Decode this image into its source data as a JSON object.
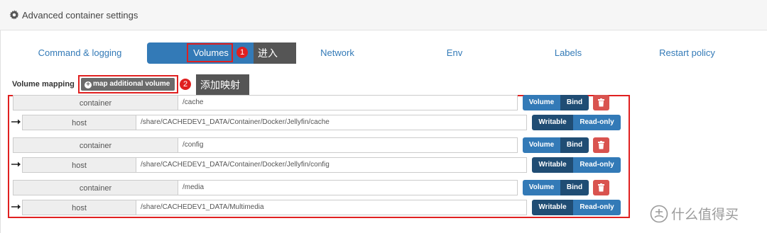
{
  "header": {
    "title": "Advanced container settings",
    "icon": "gear-icon"
  },
  "tabs": [
    {
      "label": "Command & logging",
      "active": false
    },
    {
      "label": "Volumes",
      "active": true
    },
    {
      "label": "Network",
      "active": false
    },
    {
      "label": "Env",
      "active": false
    },
    {
      "label": "Labels",
      "active": false
    },
    {
      "label": "Restart policy",
      "active": false
    }
  ],
  "annotations": {
    "step1": {
      "number": "1",
      "text": "进入"
    },
    "step2": {
      "number": "2",
      "text": "添加映射"
    }
  },
  "volume_mapping": {
    "label": "Volume mapping",
    "add_button": "map additional volume",
    "rows": [
      {
        "container_label": "container",
        "container_path": "/cache",
        "host_label": "host",
        "host_path": "/share/CACHEDEV1_DATA/Container/Docker/Jellyfin/cache",
        "type_options": [
          "Volume",
          "Bind"
        ],
        "type_selected": "Bind",
        "mode_options": [
          "Writable",
          "Read-only"
        ],
        "mode_selected": "Writable"
      },
      {
        "container_label": "container",
        "container_path": "/config",
        "host_label": "host",
        "host_path": "/share/CACHEDEV1_DATA/Container/Docker/Jellyfin/config",
        "type_options": [
          "Volume",
          "Bind"
        ],
        "type_selected": "Bind",
        "mode_options": [
          "Writable",
          "Read-only"
        ],
        "mode_selected": "Writable"
      },
      {
        "container_label": "container",
        "container_path": "/media",
        "host_label": "host",
        "host_path": "/share/CACHEDEV1_DATA/Multimedia",
        "type_options": [
          "Volume",
          "Bind"
        ],
        "type_selected": "Bind",
        "mode_options": [
          "Writable",
          "Read-only"
        ],
        "mode_selected": "Writable"
      }
    ]
  },
  "watermark": {
    "text": "什么值得买"
  },
  "colors": {
    "primary": "#337ab7",
    "primary_dark": "#265a88",
    "danger": "#d9534f",
    "highlight": "#e02020",
    "callout": "#555555"
  }
}
